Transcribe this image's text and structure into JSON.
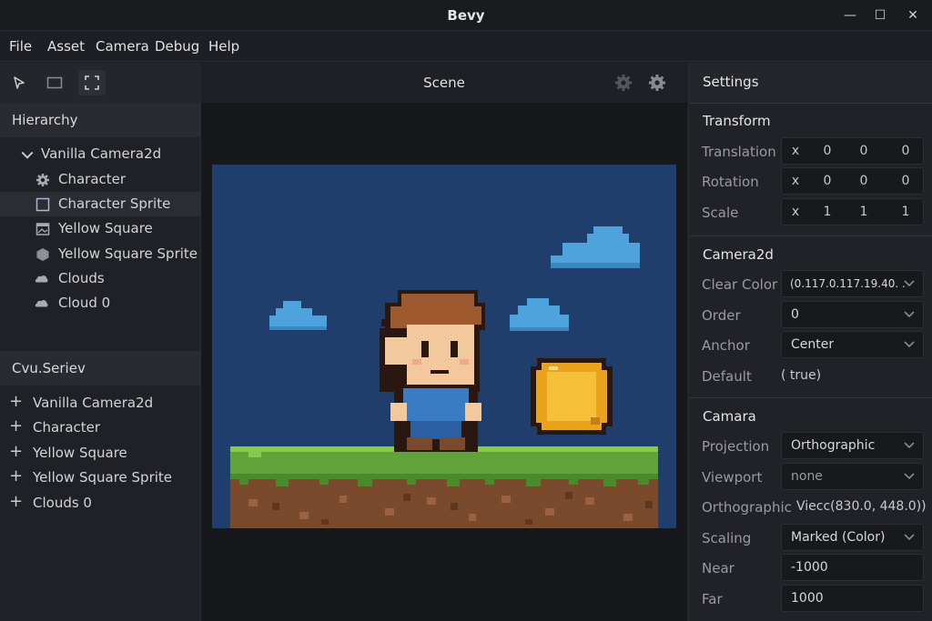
{
  "window": {
    "title": "Bevy",
    "minimize": "—",
    "maximize": "☐",
    "close": "✕"
  },
  "menu": [
    "File",
    "Asset",
    "Camera",
    "Debug",
    "Help"
  ],
  "hierarchy": {
    "title": "Hierarchy",
    "root": "Vanilla Camera2d",
    "items": [
      {
        "label": "Character",
        "icon": "gear-icon"
      },
      {
        "label": "Character Sprite",
        "icon": "square-icon"
      },
      {
        "label": "Yellow Square",
        "icon": "image-icon"
      },
      {
        "label": "Yellow Square Sprite",
        "icon": "hexagon-icon"
      },
      {
        "label": "Clouds",
        "icon": "cloud-icon"
      },
      {
        "label": "Cloud 0",
        "icon": "cloud-icon"
      }
    ]
  },
  "second_panel": {
    "title": "Cvu.Seriev",
    "items": [
      "Vanilla Camera2d",
      "Character",
      "Yellow Square",
      "Yellow Square Sprite",
      "Clouds 0"
    ]
  },
  "scene": {
    "title": "Scene"
  },
  "settings": {
    "title": "Settings",
    "transform": {
      "title": "Transform",
      "rows": [
        {
          "label": "Translation",
          "axis": "x",
          "values": [
            "0",
            "0",
            "0"
          ]
        },
        {
          "label": "Rotation",
          "axis": "x",
          "values": [
            "0",
            "0",
            "0"
          ]
        },
        {
          "label": "Scale",
          "axis": "x",
          "values": [
            "1",
            "1",
            "1"
          ]
        }
      ]
    },
    "camera2d": {
      "title": "Camera2d",
      "clear_color_label": "Clear Color",
      "clear_color": "(0.117.0.117.19.40. ...",
      "order_label": "Order",
      "order": "0",
      "anchor_label": "Anchor",
      "anchor": "Center",
      "default_label": "Default",
      "default": "( true)"
    },
    "camara": {
      "title": "Camara",
      "projection_label": "Projection",
      "projection": "Orthographic",
      "viewport_label": "Viewport",
      "viewport": "none",
      "ortho_label": "Orthographic",
      "ortho": "Viecc(830.0, 448.0))",
      "scaling_label": "Scaling",
      "scaling": "Marked (Color)",
      "near_label": "Near",
      "near": "-1000",
      "far_label": "Far",
      "far": "1000"
    }
  },
  "colors": {
    "sky": "#1f3e6c",
    "grass": "#5fa33a",
    "dirt": "#7a4a2c",
    "coin": "#f4b82c",
    "cloud": "#4fa3dd"
  }
}
